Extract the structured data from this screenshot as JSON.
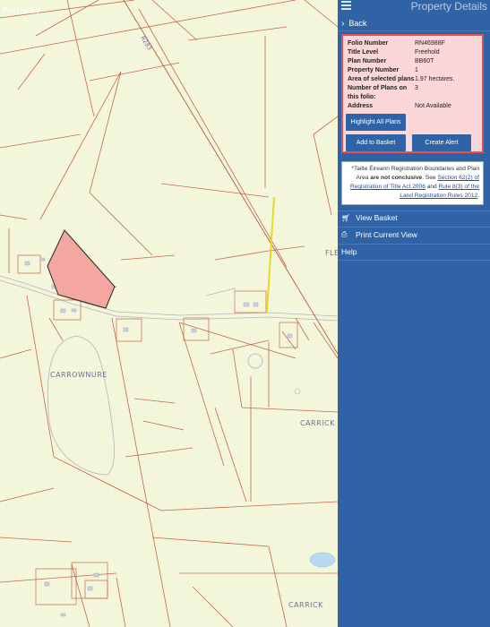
{
  "map": {
    "watermark": "Pathway",
    "road_label": "R283",
    "labels": {
      "carrownure": "CARROWNURE",
      "carrick_1": "CARRICK",
      "carrick_2": "CARRICK",
      "fle": "FLE"
    }
  },
  "panel": {
    "title": "Property Details",
    "back_label": "Back",
    "fields": [
      {
        "label": "Folio Number",
        "value": "RN46988F"
      },
      {
        "label": "Title Level",
        "value": "Freehold"
      },
      {
        "label": "Plan Number",
        "value": "BB60T"
      },
      {
        "label": "Property Number",
        "value": "1"
      },
      {
        "label": "Area of selected plans",
        "value": "1.97 hectares."
      },
      {
        "label": "Number of Plans on this folio:",
        "value": "3"
      },
      {
        "label": "Address",
        "value": "Not Available"
      }
    ],
    "highlight_button": "Highlight All Plans",
    "basket_button": "Add to Basket",
    "alert_button": "Create Alert",
    "note": {
      "prefix": "*Tailte Éireann Registration Boundaries and Plan Area ",
      "bold": "are not conclusive",
      "mid1": ". See ",
      "link1": "Section 62(2) of Registration of Title Act 2006",
      "mid2": " and ",
      "link2": "Rule 8(3) of the Land Registration Rules 2012",
      "suffix": "."
    },
    "menu": {
      "view_basket": "View Basket",
      "print_view": "Print Current View",
      "help": "Help"
    }
  },
  "colors": {
    "panel_bg": "#2f63a6",
    "highlight_fill": "#f4a6a0",
    "boundary": "#c8664a",
    "selected_line": "#e8d820",
    "info_border": "#e35252"
  }
}
